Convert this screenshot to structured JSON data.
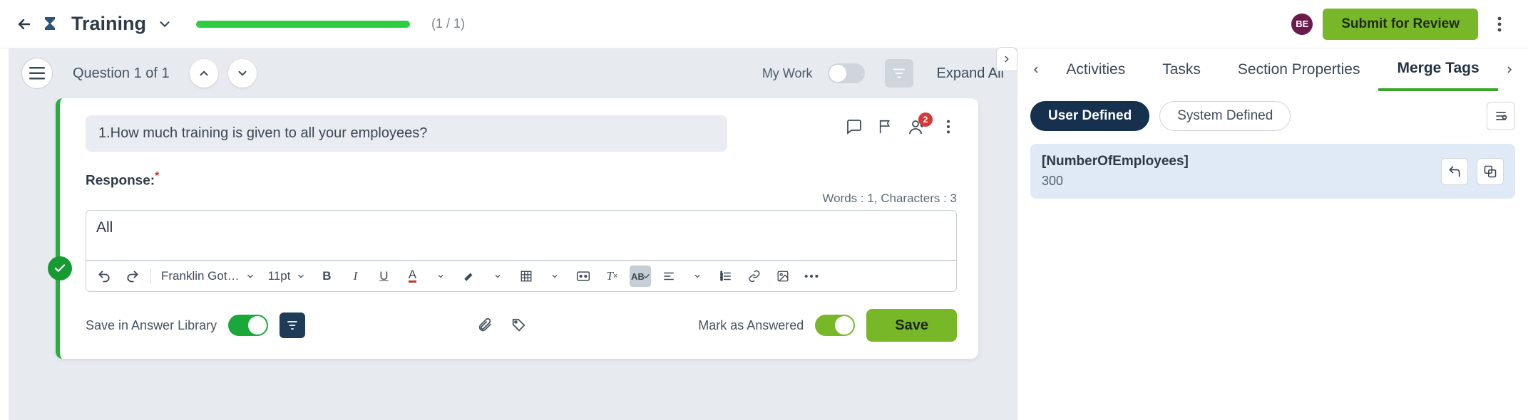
{
  "header": {
    "title": "Training",
    "progress_pct": 100,
    "progress_text": "(1 / 1)",
    "avatar_initials": "BE",
    "submit_label": "Submit for Review"
  },
  "workspace": {
    "question_counter": "Question 1 of 1",
    "my_work_label": "My Work",
    "expand_all_label": "Expand All"
  },
  "question": {
    "text": "1.How much training is given to all your employees?",
    "assignee_badge": 2,
    "response_label": "Response:",
    "words_chars": "Words : 1, Characters : 3",
    "response_value": "All",
    "editor": {
      "font_family": "Franklin Got…",
      "font_size": "11pt"
    },
    "footer": {
      "save_library_label": "Save in Answer Library",
      "mark_answered_label": "Mark as Answered",
      "save_label": "Save"
    }
  },
  "right_panel": {
    "tabs": {
      "activities": "Activities",
      "tasks": "Tasks",
      "section_properties": "Section Properties",
      "merge_tags": "Merge Tags"
    },
    "filters": {
      "user_defined": "User Defined",
      "system_defined": "System Defined"
    },
    "tags": [
      {
        "name": "[NumberOfEmployees]",
        "value": "300"
      }
    ]
  }
}
